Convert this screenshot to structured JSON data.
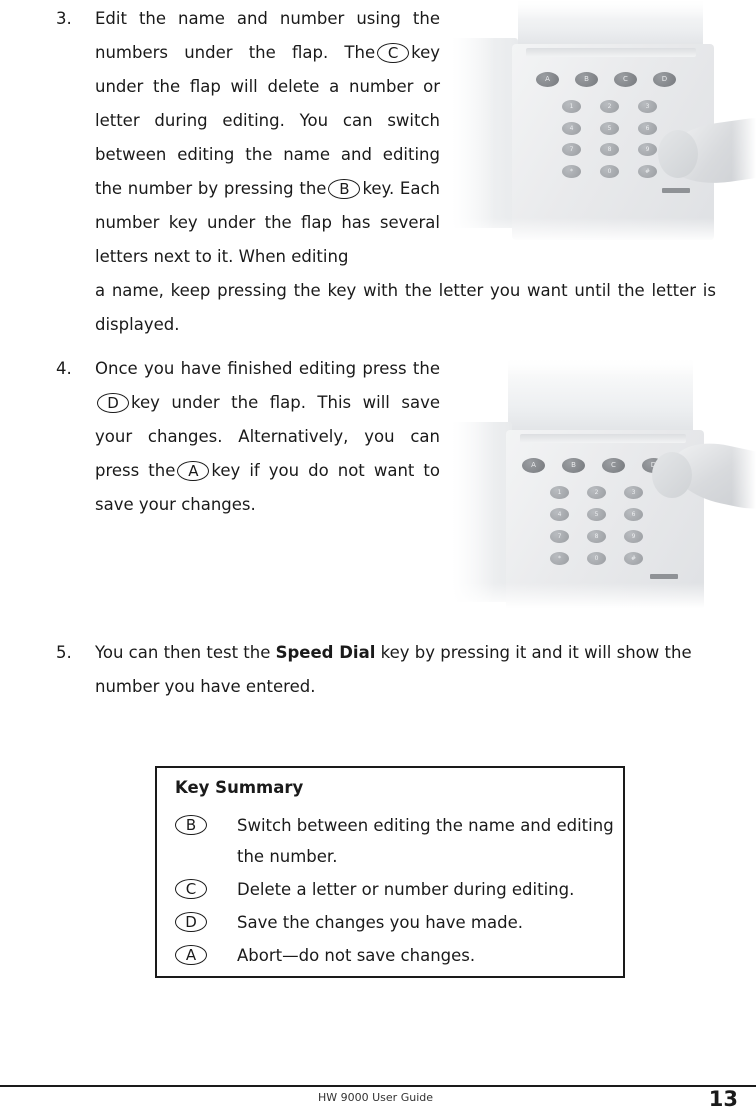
{
  "document": {
    "footer": {
      "guide_title": "HW 9000 User Guide",
      "page_number": "13"
    }
  },
  "steps": [
    {
      "number": "3.",
      "narrow_part_1": "Edit the name and number using the numbers under the flap. The",
      "key_1": "C",
      "narrow_part_2": "key under the flap will delete a number or letter during editing. You can switch between editing the name and editing the number by pressing the",
      "key_2": "B",
      "narrow_part_3": "key. Each number key under the flap has several letters next to it. When editing",
      "wide_part": "a name, keep pressing the key with the letter you want until the letter is displayed."
    },
    {
      "number": "4.",
      "narrow_part_1": "Once you have finished editing press the",
      "key_1": "D",
      "narrow_part_2": "key under the flap. This will save your changes. Alternatively, you can press the",
      "key_2": "A",
      "narrow_part_3": "key if you do not want to save your changes."
    },
    {
      "number": "5.",
      "text_before_bold": "You can then test the ",
      "bold_text": "Speed Dial",
      "text_after_bold": " key by pressing it and it will show the number you have entered."
    }
  ],
  "photos": [
    {
      "caption_role": "phone-keypad-editing-photo",
      "function_keys": [
        "A",
        "B",
        "C",
        "D"
      ],
      "number_keys": [
        "1",
        "2",
        "3",
        "4",
        "5",
        "6",
        "7",
        "8",
        "9",
        "*",
        "0",
        "#"
      ],
      "finger_target": "9"
    },
    {
      "caption_role": "phone-keypad-save-photo",
      "function_keys": [
        "A",
        "B",
        "C",
        "D"
      ],
      "number_keys": [
        "1",
        "2",
        "3",
        "4",
        "5",
        "6",
        "7",
        "8",
        "9",
        "*",
        "0",
        "#"
      ],
      "finger_target": "D"
    }
  ],
  "key_summary": {
    "title": "Key Summary",
    "rows": [
      {
        "key": "B",
        "description": "Switch between editing the name and editing the number."
      },
      {
        "key": "C",
        "description": "Delete a letter or number during editing."
      },
      {
        "key": "D",
        "description": "Save the changes you have made."
      },
      {
        "key": "A",
        "description": "Abort—do not save changes."
      }
    ]
  },
  "colors": {
    "text": "#1a1a1a",
    "rule": "#1a1a1a",
    "box_border": "#1a1a1a",
    "page_background": "#ffffff"
  }
}
